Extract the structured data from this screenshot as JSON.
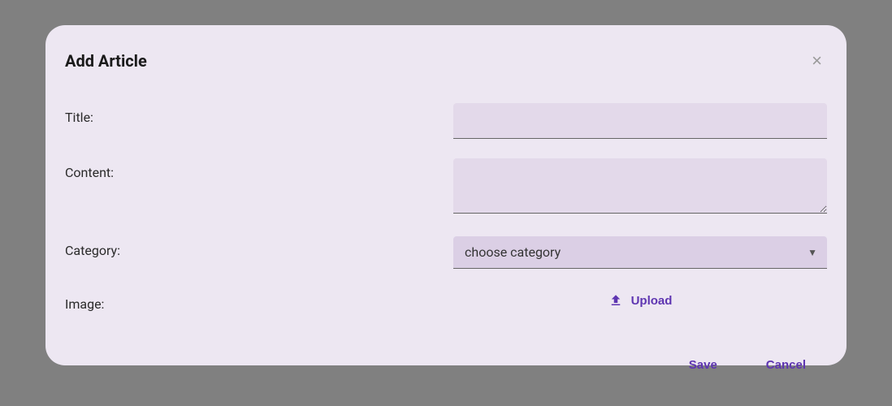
{
  "modal": {
    "title": "Add Article",
    "fields": {
      "title": {
        "label": "Title:",
        "value": ""
      },
      "content": {
        "label": "Content:",
        "value": ""
      },
      "category": {
        "label": "Category:",
        "placeholder": "choose category",
        "value": ""
      },
      "image": {
        "label": "Image:",
        "upload_label": "Upload"
      }
    },
    "actions": {
      "save": "Save",
      "cancel": "Cancel"
    }
  },
  "colors": {
    "accent": "#5e35b1",
    "modal_bg": "#ede7f2",
    "input_bg": "#e3d9ea",
    "select_bg": "#dbcfe5"
  }
}
